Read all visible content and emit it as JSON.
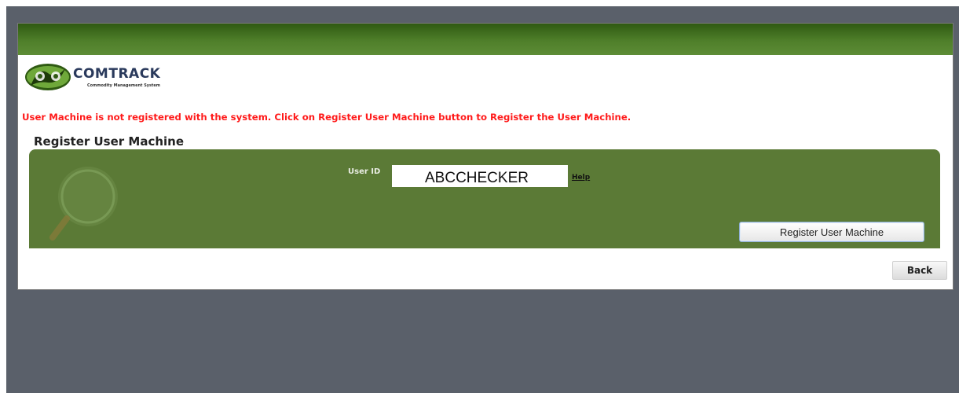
{
  "logo": {
    "name": "COMTRACK",
    "tagline": "Commodity Management System"
  },
  "error_message": "User Machine is not registered with the system. Click on Register User Machine button to Register the User Machine.",
  "section_title": "Register User Machine",
  "form": {
    "user_id_label": "User ID",
    "user_id_value": "ABCCHECKER",
    "help_label": "Help"
  },
  "buttons": {
    "register_label": "Register User Machine",
    "back_label": "Back"
  },
  "colors": {
    "header_green": "#4f7f2a",
    "panel_green": "#5b7a36",
    "error_red": "#ff1a1a",
    "backdrop_gray": "#5a606a"
  }
}
